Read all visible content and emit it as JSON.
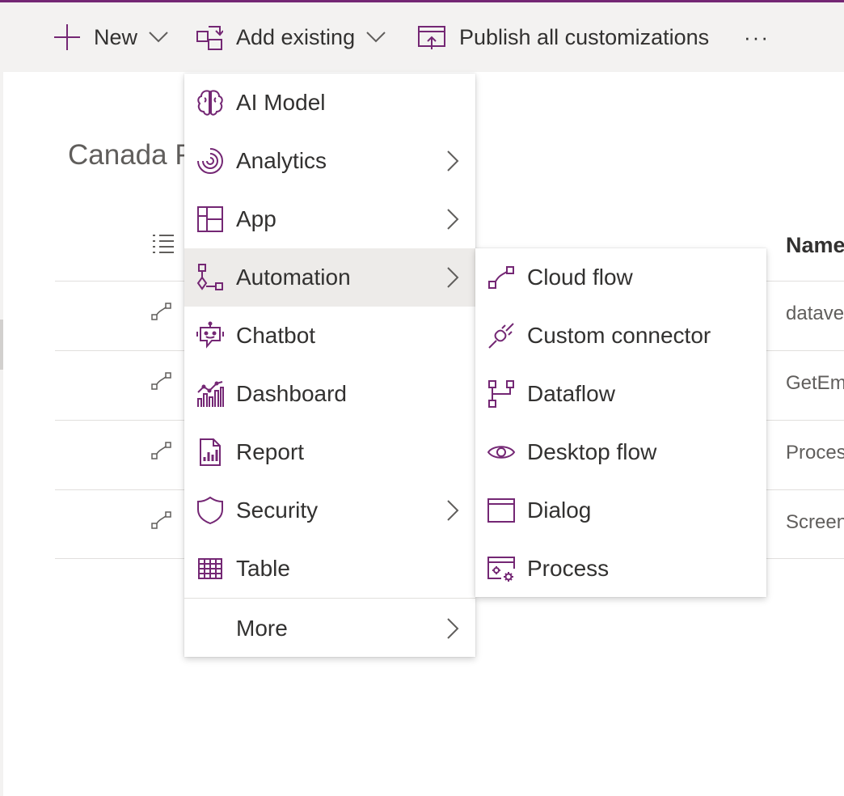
{
  "commandbar": {
    "new_label": "New",
    "add_existing_label": "Add existing",
    "publish_label": "Publish all customizations",
    "more_label": "···"
  },
  "page": {
    "title": "Canada P",
    "column_name": "Name",
    "rows": [
      {
        "name": "datave"
      },
      {
        "name": "GetEm"
      },
      {
        "name": "Process"
      },
      {
        "name": "Screen"
      }
    ]
  },
  "menu": {
    "items": [
      {
        "label": "AI Model",
        "icon": "ai-model-icon"
      },
      {
        "label": "Analytics",
        "icon": "analytics-icon",
        "has_submenu": true
      },
      {
        "label": "App",
        "icon": "app-icon",
        "has_submenu": true
      },
      {
        "label": "Automation",
        "icon": "automation-icon",
        "has_submenu": true,
        "active": true
      },
      {
        "label": "Chatbot",
        "icon": "chatbot-icon"
      },
      {
        "label": "Dashboard",
        "icon": "dashboard-icon"
      },
      {
        "label": "Report",
        "icon": "report-icon"
      },
      {
        "label": "Security",
        "icon": "shield-icon",
        "has_submenu": true
      },
      {
        "label": "Table",
        "icon": "table-icon"
      }
    ],
    "more_label": "More"
  },
  "submenu": {
    "items": [
      {
        "label": "Cloud flow",
        "icon": "cloud-flow-icon"
      },
      {
        "label": "Custom connector",
        "icon": "plug-icon"
      },
      {
        "label": "Dataflow",
        "icon": "dataflow-icon"
      },
      {
        "label": "Desktop flow",
        "icon": "eye-icon"
      },
      {
        "label": "Dialog",
        "icon": "window-icon"
      },
      {
        "label": "Process",
        "icon": "process-gear-icon"
      }
    ]
  },
  "colors": {
    "accent": "#742774",
    "commandbar_bg": "#f3f2f1",
    "hover_bg": "#edebe9",
    "text": "#323130",
    "muted_text": "#605e5c"
  }
}
